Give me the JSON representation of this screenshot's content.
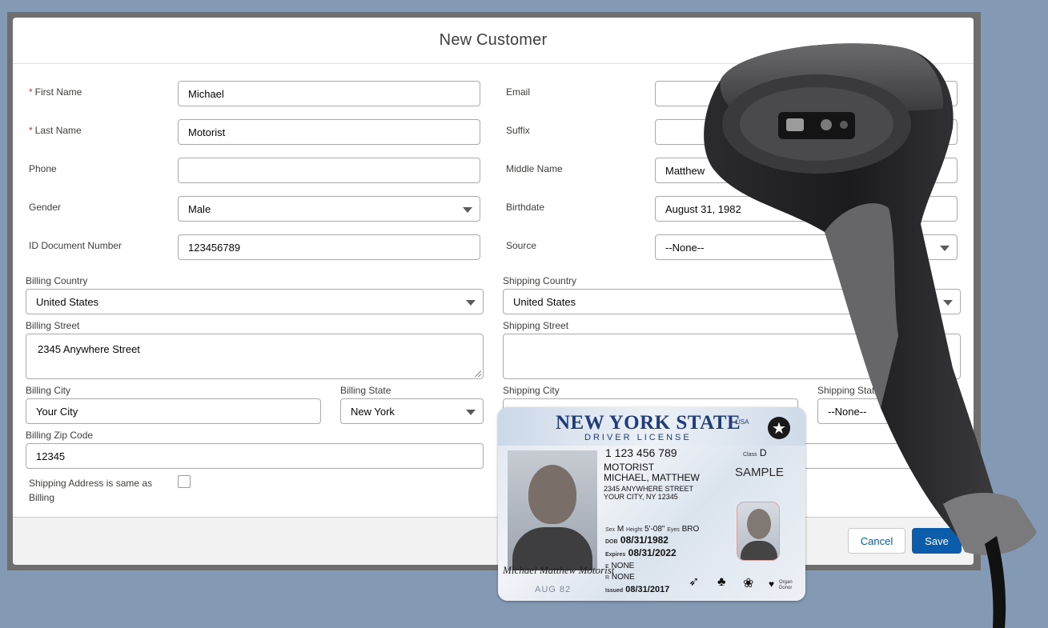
{
  "modal": {
    "title": "New Customer"
  },
  "left_fields": [
    {
      "label": "First Name",
      "required": "*",
      "value": "Michael"
    },
    {
      "label": "Last Name",
      "required": "*",
      "value": "Motorist"
    },
    {
      "label": "Phone",
      "value": ""
    },
    {
      "label": "Gender",
      "value": "Male"
    },
    {
      "label": "ID Document Number",
      "value": "123456789"
    }
  ],
  "right_fields": [
    {
      "label": "Email",
      "value": ""
    },
    {
      "label": "Suffix",
      "value": ""
    },
    {
      "label": "Middle Name",
      "value": "Matthew"
    },
    {
      "label": "Birthdate",
      "value": "August 31, 1982"
    },
    {
      "label": "Source",
      "value": "--None--"
    }
  ],
  "billing": {
    "country_label": "Billing Country",
    "country": "United States",
    "street_label": "Billing Street",
    "street": "2345 Anywhere Street",
    "city_label": "Billing City",
    "city": "Your City",
    "state_label": "Billing State",
    "state": "New York",
    "zip_label": "Billing Zip Code",
    "zip": "12345"
  },
  "shipping": {
    "country_label": "Shipping Country",
    "country": "United States",
    "street_label": "Shipping Street",
    "street": "",
    "city_label": "Shipping City",
    "city": "",
    "state_label": "Shipping State",
    "state": "--None--",
    "same_as_billing_label_1": "Shipping Address is same as",
    "same_as_billing_label_2": "Billing",
    "same_as_billing": false
  },
  "footer": {
    "cancel": "Cancel",
    "save": "Save"
  },
  "license": {
    "state": "NEW YORK STATE",
    "country": "USA",
    "type": "DRIVER LICENSE",
    "id": "1 123 456 789",
    "class_label": "Class",
    "class": "D",
    "sample": "SAMPLE",
    "last_name": "MOTORIST",
    "first_names": "MICHAEL, MATTHEW",
    "address_1": "2345 ANYWHERE STREET",
    "address_2": "YOUR CITY, NY  12345",
    "sex_label": "Sex",
    "sex": "M",
    "height_label": "Height",
    "height": "5'-08\"",
    "eyes_label": "Eyes",
    "eyes": "BRO",
    "dob_label": "DOB",
    "dob": "08/31/1982",
    "expires_label": "Expires",
    "expires": "08/31/2022",
    "e_label": "E",
    "e_value": "NONE",
    "r_label": "R",
    "r_value": "NONE",
    "issued_label": "Issued",
    "issued": "08/31/2017",
    "signature": "Michael Matthew Motorist",
    "aug": "AUG 82",
    "organ_donor": "Organ Donor"
  },
  "colors": {
    "brand": "#0b5cab",
    "required": "#c23934",
    "backdrop": "#8499b4",
    "card_title": "#1f3d7a"
  }
}
